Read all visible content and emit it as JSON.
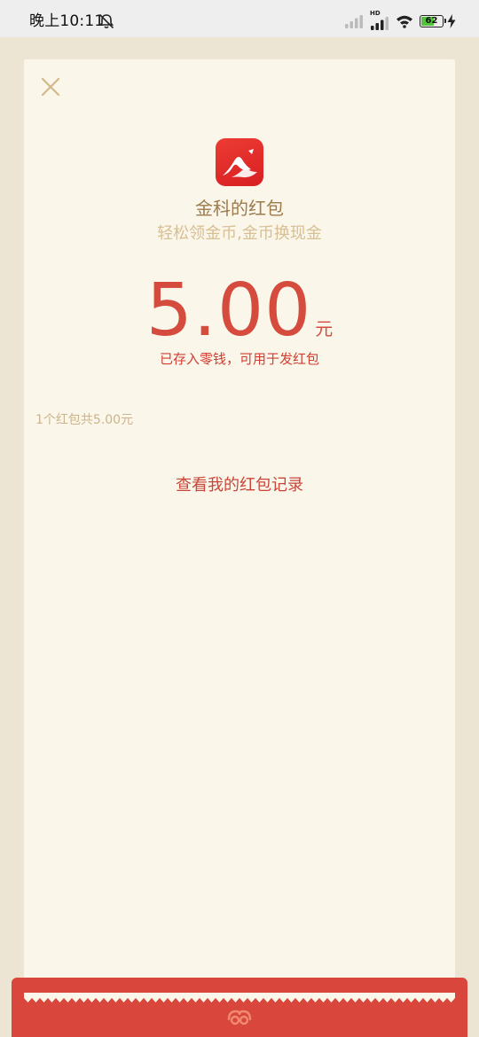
{
  "status_bar": {
    "time": "晚上10:11",
    "network_badge": "HD",
    "battery_level": "62",
    "battery_percent": 62,
    "icons": [
      "alarm-off-icon",
      "cellular-signal-icon",
      "cellular-signal-hd-icon",
      "wifi-icon",
      "battery-icon",
      "charging-icon"
    ]
  },
  "red_packet": {
    "close_icon": "close-icon",
    "app_icon": "app-logo-icon",
    "sender_name": "金科的红包",
    "slogan": "轻松领金币,金币换现金",
    "amount": "5.00",
    "currency_unit": "元",
    "saved_note": "已存入零钱，可用于发红包",
    "summary": "1个红包共5.00元",
    "record_link": "查看我的红包记录"
  },
  "footer": {
    "brand_icon": "wechat-pay-logo-icon"
  },
  "colors": {
    "page_background": "#ede5d3",
    "card_background": "#fbf6ea",
    "accent_red": "#d54b3e",
    "gold_text": "#9c7b4c",
    "light_gold_text": "#d7bf93"
  }
}
